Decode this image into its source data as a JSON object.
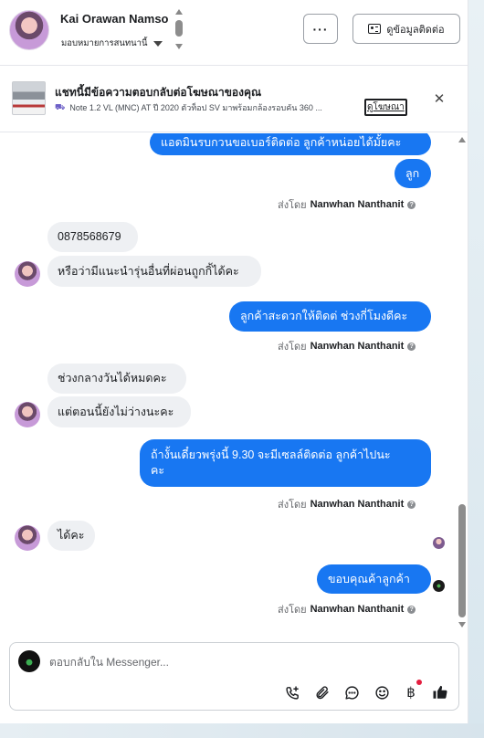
{
  "header": {
    "contact_name": "Kai Orawan Namso",
    "assign_label": "มอบหมายการสนทนานี้",
    "more_label": "···",
    "contact_info_label": "ดูข้อมูลติดต่อ"
  },
  "ad": {
    "title": "แชทนี้มีข้อความตอบกลับต่อโฆษณาของคุณ",
    "subtitle": "Note 1.2 VL (MNC) AT ปี 2020 ตัวท็อป SV มาพร้อมกล้องรอบคัน 360 ...",
    "link_label": "ดูโฆษณา",
    "close_icon": "close-icon"
  },
  "messages": {
    "m1": "แอดมินรบกวนขอเบอร์ติดต่อ ลูกค้าหน่อยได้มั้ยคะ",
    "m2": "ลูก",
    "sent_by_prefix": "ส่งโดย",
    "agent_name": "Nanwhan Nanthanit",
    "m3": "0878568679",
    "m4": "หรือว่ามีแนะนำรุ่นอื่นที่ผ่อนถูกกิ้ได้คะ",
    "m5": "ลูกค้าสะดวกให้ติดต่ ช่วงกี่โมงดีคะ",
    "m6": "ช่วงกลางวันได้หมดคะ",
    "m7": "แต่ตอนนี้ยังไม่ว่างนะคะ",
    "m8_line1": "ถ้างั้นเดี๋ยวพรุ่งนี้ 9.30 จะมีเซลล์ติดต่อ ลูกค้าไปนะ",
    "m8_line2": "คะ",
    "m9": "ได้คะ",
    "m10": "ขอบคุณค้าลูกค้า"
  },
  "composer": {
    "placeholder": "ตอบกลับใน Messenger..."
  },
  "colors": {
    "outgoing_bubble": "#1877f2",
    "incoming_bubble": "#eef0f3",
    "notify_dot": "#e41e3f"
  }
}
